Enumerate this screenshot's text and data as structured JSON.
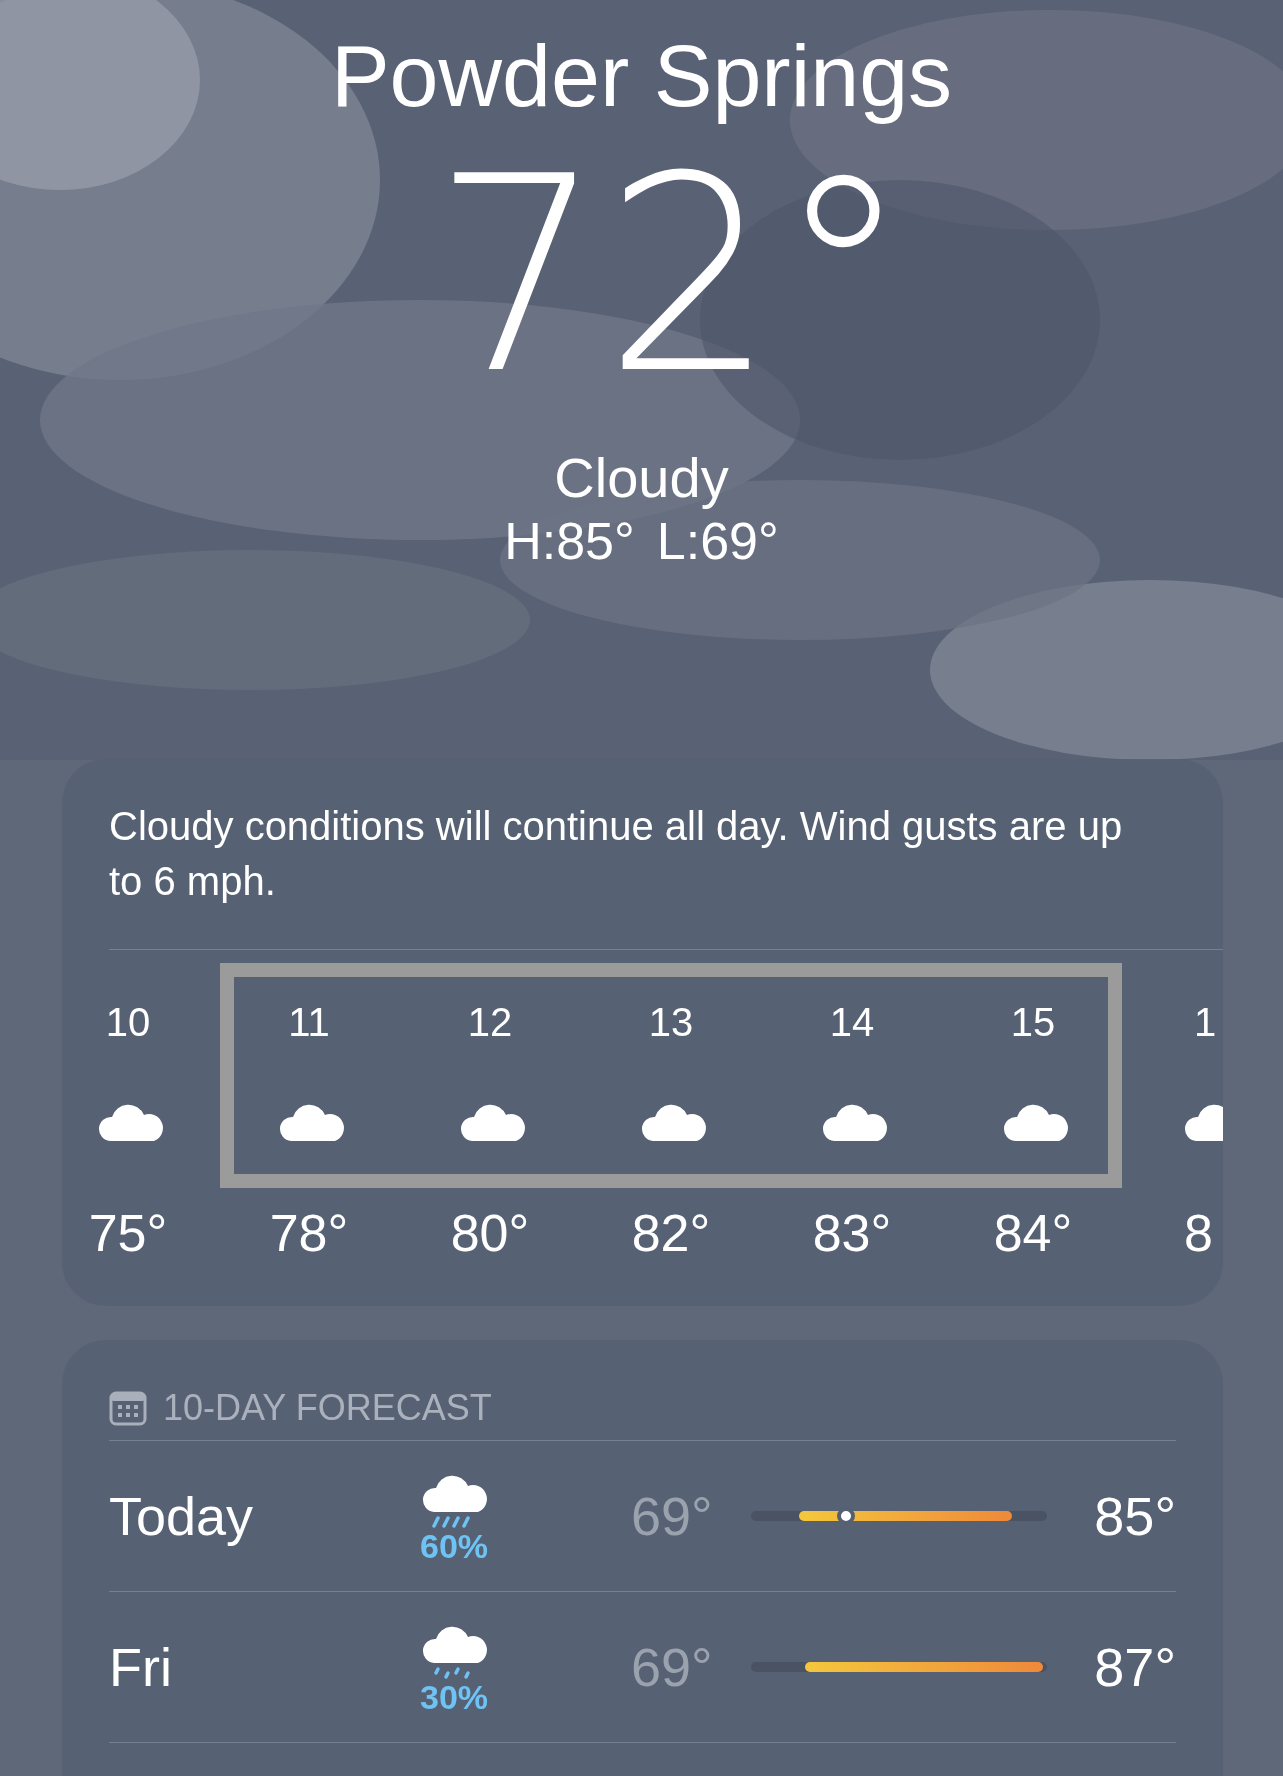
{
  "location": "Powder Springs",
  "temperature": "72°",
  "condition": "Cloudy",
  "high": "H:85°",
  "low": "L:69°",
  "summary": "Cloudy conditions will continue all day. Wind gusts are up to 6 mph.",
  "hourly": [
    {
      "highlighted": false,
      "hours": [
        {
          "hour": "10",
          "temp": "75°"
        }
      ]
    },
    {
      "highlighted": true,
      "hours": [
        {
          "hour": "11",
          "temp": "78°"
        },
        {
          "hour": "12",
          "temp": "80°"
        },
        {
          "hour": "13",
          "temp": "82°"
        },
        {
          "hour": "14",
          "temp": "83°"
        },
        {
          "hour": "15",
          "temp": "84°"
        }
      ]
    },
    {
      "highlighted": false,
      "hours": [
        {
          "hour": "1",
          "temp": "8"
        }
      ]
    }
  ],
  "forecast": {
    "title": "10-DAY FORECAST",
    "days": [
      {
        "day": "Today",
        "kind": "rain",
        "chance": "60%",
        "low": "69°",
        "high": "85°",
        "range_start": {
          "level": 0.18
        },
        "range_end": {
          "level": 0.865
        },
        "current": {
          "level": 0.32
        }
      },
      {
        "day": "Fri",
        "kind": "drizzle",
        "chance": "30%",
        "low": "69°",
        "high": "87°",
        "range_start": {
          "level": 0.2
        },
        "range_end": {
          "level": 0.97
        }
      }
    ]
  }
}
